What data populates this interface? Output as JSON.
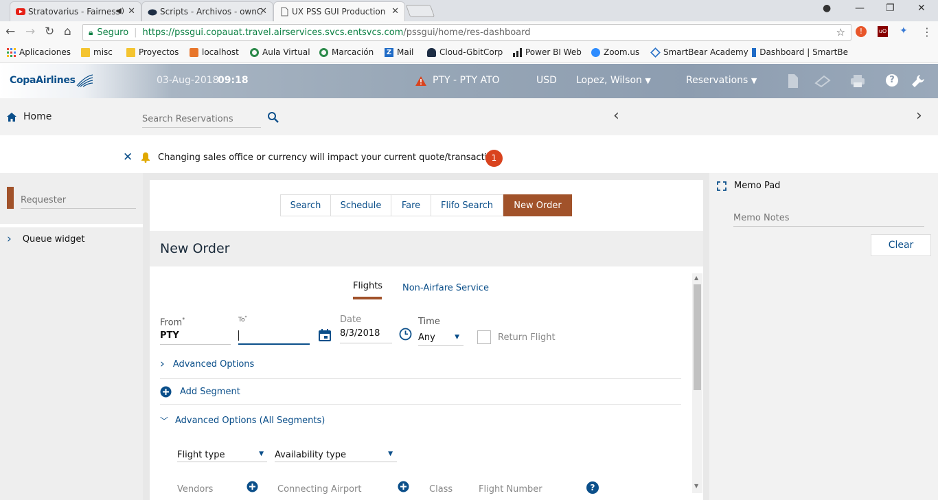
{
  "browser": {
    "tabs": [
      {
        "title": "Stratovarius - Fairness",
        "icon": "youtube-icon"
      },
      {
        "title": "Scripts - Archivos - ownC",
        "icon": "owncloud-icon"
      },
      {
        "title": "UX PSS GUI Production",
        "icon": "page-icon"
      }
    ],
    "secure_label": "Seguro",
    "url_host": "https://pssgui.copauat.travel.airservices.svcs.entsvcs.com",
    "url_path": "/pssgui/home/res-dashboard",
    "bookmarks": [
      "Aplicaciones",
      "misc",
      "Proyectos",
      "localhost",
      "Aula Virtual",
      "Marcación",
      "Mail",
      "Cloud-GbitCorp",
      "Power BI Web",
      "Zoom.us",
      "SmartBear Academy",
      "Dashboard | SmartBe"
    ]
  },
  "header": {
    "logo_text": "CopaAirlines",
    "date": "03-Aug-2018",
    "time": "09:18",
    "office": "PTY - PTY ATO",
    "currency": "USD",
    "user": "Lopez, Wilson",
    "reservations": "Reservations"
  },
  "subnav": {
    "home": "Home",
    "search_placeholder": "Search Reservations"
  },
  "alert": {
    "message": "Changing sales office or currency will impact your current quote/transaction",
    "count": "1"
  },
  "left": {
    "requester_placeholder": "Requester",
    "queue_widget": "Queue widget"
  },
  "main": {
    "tabs": [
      "Search",
      "Schedule",
      "Fare",
      "Flifo Search",
      "New Order"
    ],
    "title": "New Order",
    "subtabs": [
      "Flights",
      "Non-Airfare Service"
    ],
    "from_label": "From",
    "from_value": "PTY",
    "to_label": "To",
    "date_label": "Date",
    "date_value": "8/3/2018",
    "time_label": "Time",
    "time_value": "Any",
    "return_flight": "Return Flight",
    "advanced_options": "Advanced Options",
    "add_segment": "Add Segment",
    "advanced_all": "Advanced Options (All Segments)",
    "flight_type": "Flight type",
    "availability_type": "Availability type",
    "vendors": "Vendors",
    "connecting_airport": "Connecting Airport",
    "class": "Class",
    "flight_number": "Flight Number"
  },
  "right": {
    "memo_pad": "Memo Pad",
    "memo_placeholder": "Memo Notes",
    "clear": "Clear"
  },
  "colors": {
    "accent": "#a1522a",
    "link": "#0b4f8a",
    "alert_badge": "#d9431e",
    "bell": "#e0a800"
  }
}
